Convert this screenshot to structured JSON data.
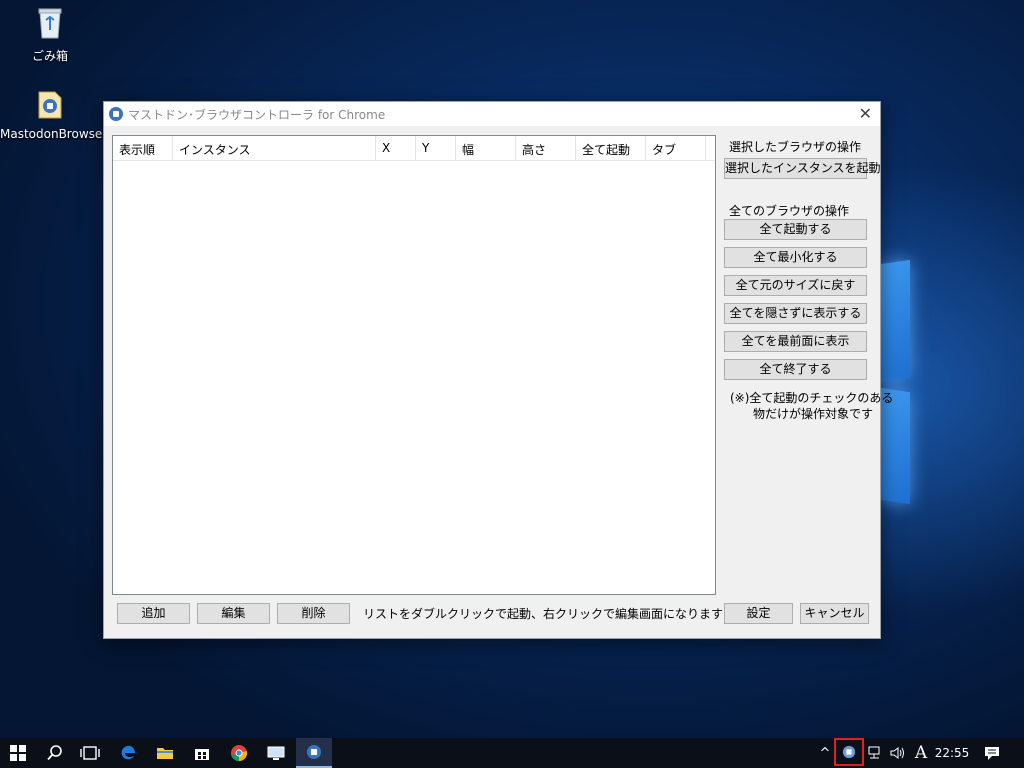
{
  "desktop": {
    "icons": [
      {
        "label": "ごみ箱",
        "icon": "recycle-bin-icon"
      },
      {
        "label": "MastodonBrowser",
        "icon": "app-shortcut-icon"
      }
    ]
  },
  "window": {
    "title": "マストドン･ブラウザコントローラ for Chrome",
    "close_glyph": "✕",
    "columns": [
      "表示順",
      "インスタンス",
      "X",
      "Y",
      "幅",
      "高さ",
      "全て起動",
      "タブ"
    ],
    "selected_section_label": "選択したブラウザの操作",
    "launch_selected_button": "選択したインスタンスを起動",
    "all_section_label": "全てのブラウザの操作",
    "all_buttons": [
      "全て起動する",
      "全て最小化する",
      "全て元のサイズに戻す",
      "全てを隠さずに表示する",
      "全てを最前面に表示",
      "全て終了する"
    ],
    "note_line1": "(※)全て起動のチェックのある",
    "note_line2": "物だけが操作対象です",
    "add_button": "追加",
    "edit_button": "編集",
    "delete_button": "削除",
    "hint": "リストをダブルクリックで起動、右クリックで編集画面になります",
    "settings_button": "設定",
    "cancel_button": "キャンセル"
  },
  "taskbar": {
    "clock": "22:55",
    "ime": "A",
    "tray_expand": "^",
    "highlight_color": "#e02020"
  }
}
